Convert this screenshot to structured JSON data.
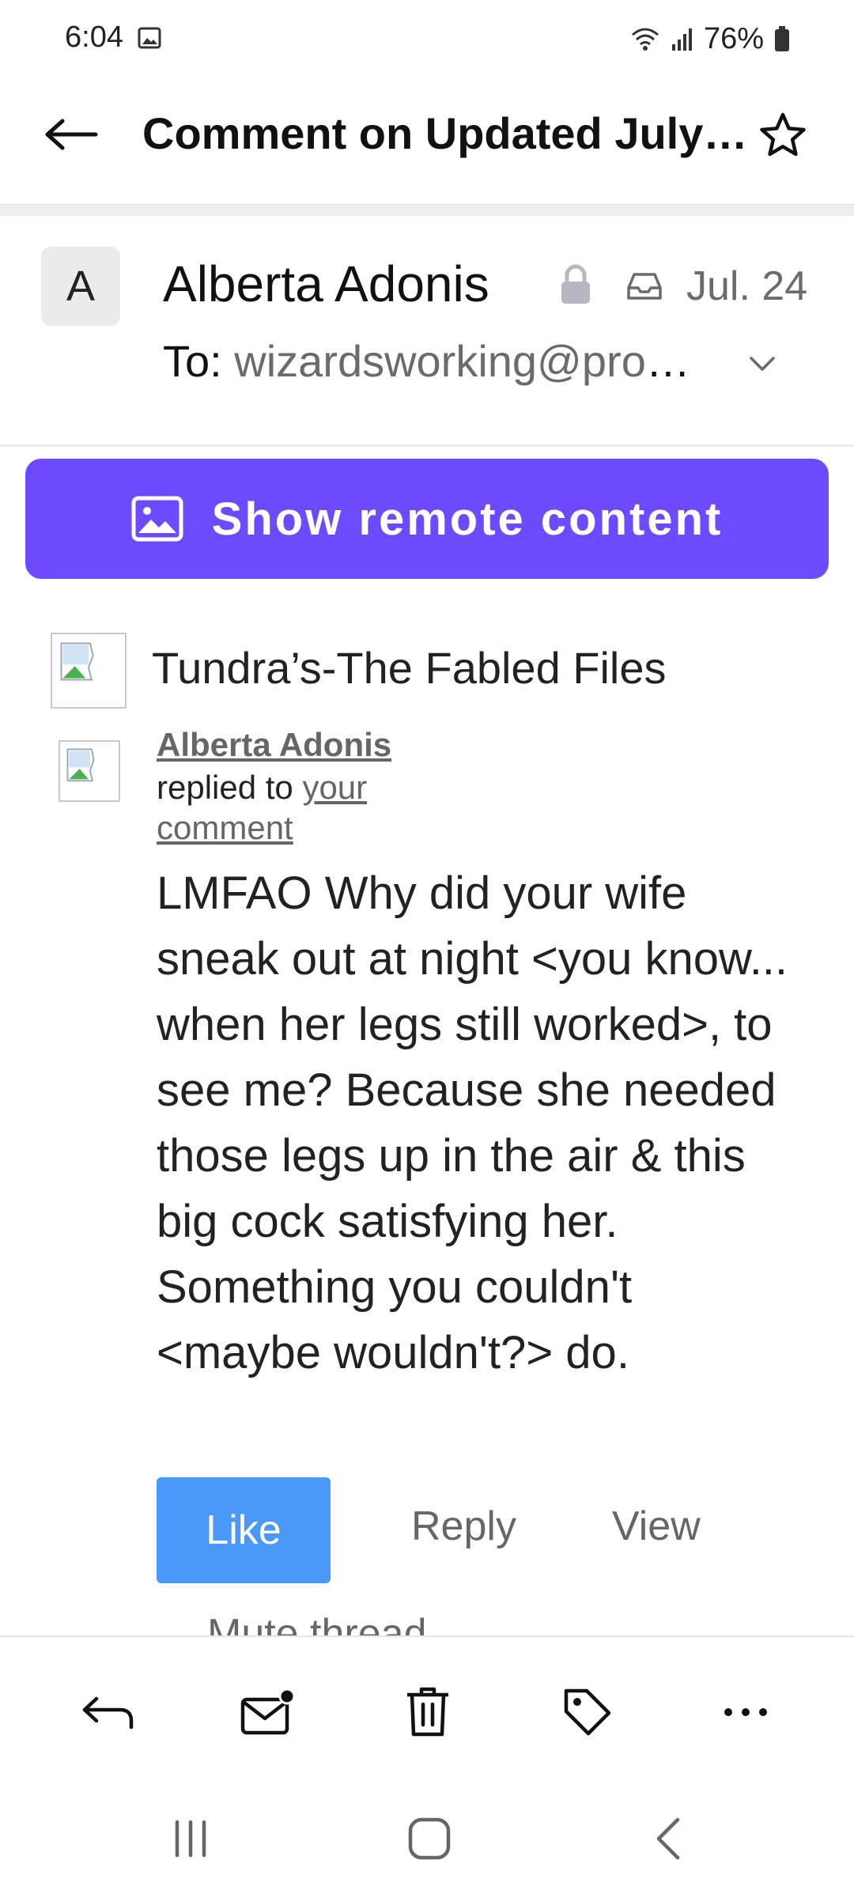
{
  "status_bar": {
    "time": "6:04",
    "battery": "76%"
  },
  "app_bar": {
    "title": "Comment on Updated July Release: Tundra's-The Fabled Files"
  },
  "message": {
    "avatar_letter": "A",
    "sender": "Alberta Adonis",
    "date": "Jul. 24",
    "to_label": "To:",
    "to_address": "wizardsworking@proton.me"
  },
  "remote_content": {
    "label": "Show remote content"
  },
  "body": {
    "fabled_title": "Tundra’s-The Fabled Files",
    "commenter": "Alberta Adonis",
    "replied_prefix": "replied to",
    "replied_link": "your comment",
    "comment": "LMFAO Why did your wife sneak out at night <you know... when her legs still worked>, to see me? Because she needed those legs up in the air & this big cock satisfying her. Something you couldn't <maybe wouldn't?> do."
  },
  "actions": {
    "like": "Like",
    "reply": "Reply",
    "view": "View",
    "mute": "Mute thread"
  },
  "colors": {
    "accent": "#6d4aff",
    "like_button": "#4a98f7"
  }
}
